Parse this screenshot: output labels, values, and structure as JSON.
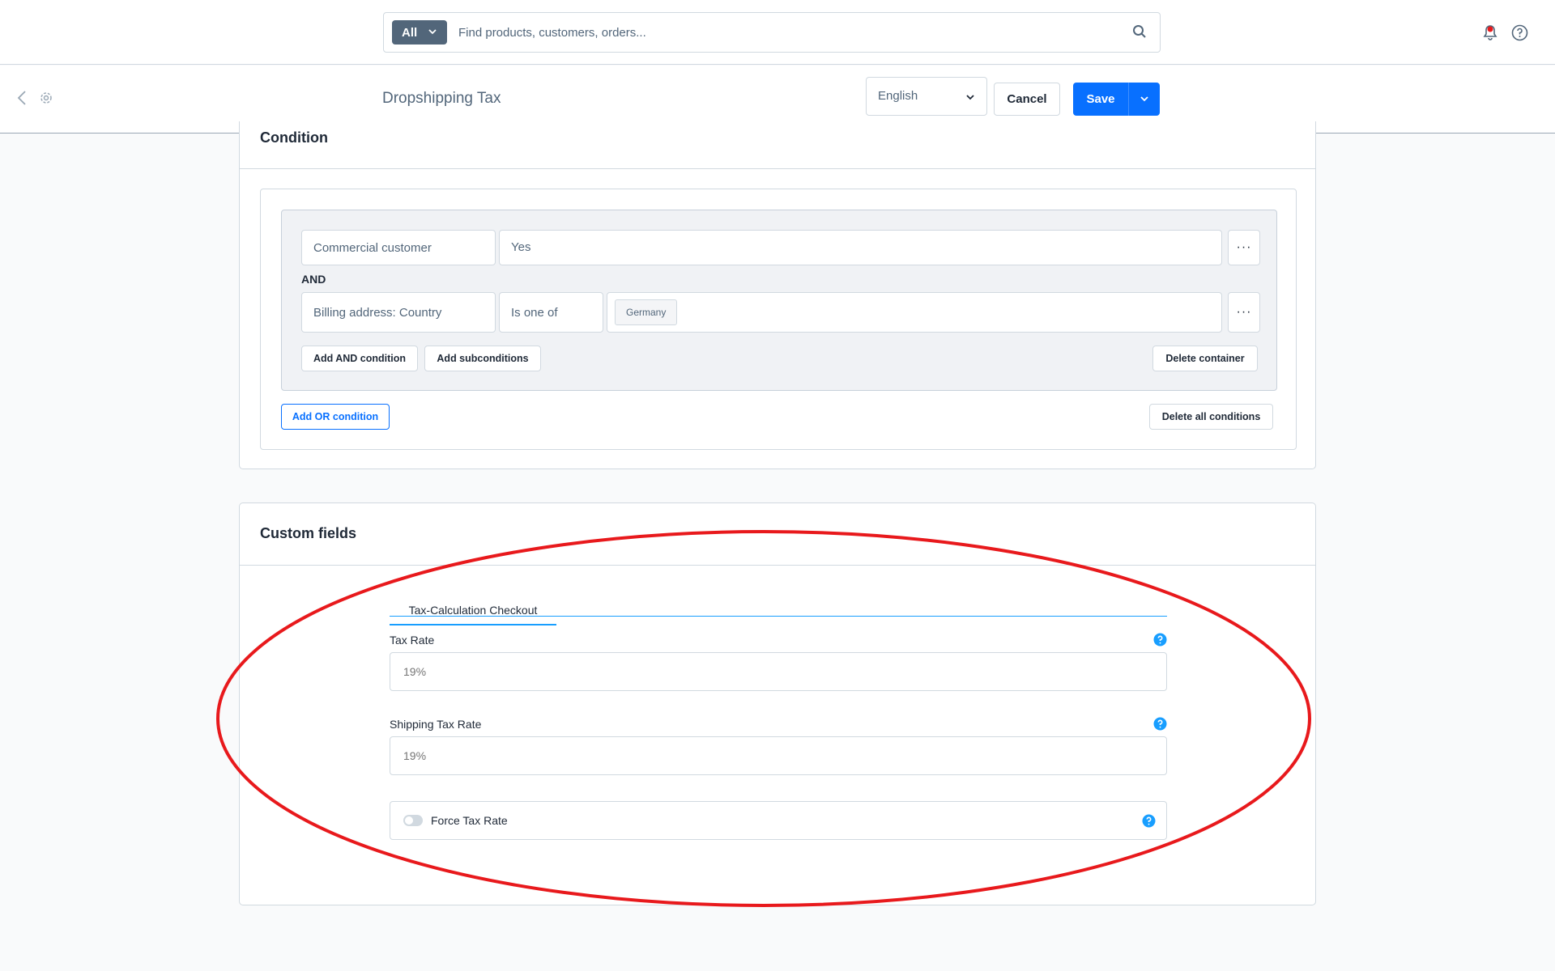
{
  "search": {
    "type_label": "All",
    "placeholder": "Find products, customers, orders..."
  },
  "header": {
    "title": "Dropshipping Tax",
    "language": "English",
    "cancel_label": "Cancel",
    "save_label": "Save"
  },
  "condition": {
    "title": "Condition",
    "row1": {
      "field": "Commercial customer",
      "value": "Yes"
    },
    "and_label": "AND",
    "row2": {
      "field": "Billing address: Country",
      "operator": "Is one of",
      "tag": "Germany"
    },
    "add_and_label": "Add AND condition",
    "add_sub_label": "Add subconditions",
    "delete_container_label": "Delete container",
    "add_or_label": "Add OR condition",
    "delete_all_label": "Delete all conditions",
    "more_label": "···"
  },
  "custom_fields": {
    "title": "Custom fields",
    "tab_label": "Tax-Calculation Checkout",
    "tax_rate": {
      "label": "Tax Rate",
      "placeholder": "19%"
    },
    "shipping_tax_rate": {
      "label": "Shipping Tax Rate",
      "placeholder": "19%"
    },
    "force_tax_rate": {
      "label": "Force Tax Rate",
      "enabled": false
    }
  },
  "colors": {
    "primary": "#0870ff",
    "annotation": "#e8191c",
    "help": "#189eff"
  }
}
